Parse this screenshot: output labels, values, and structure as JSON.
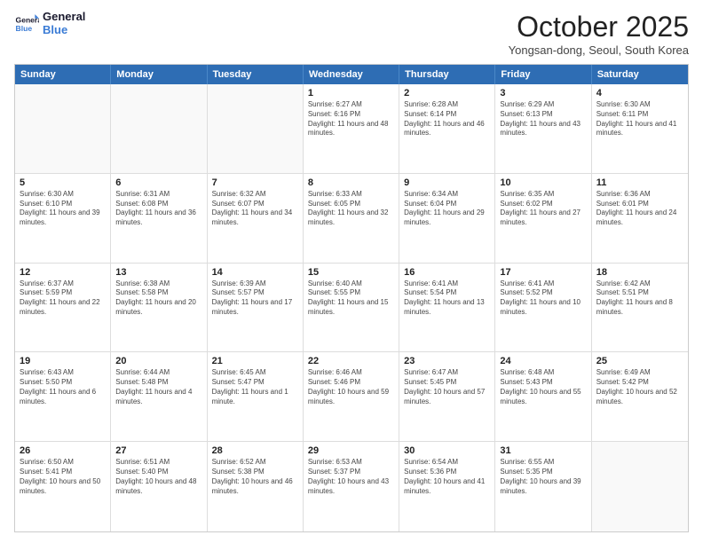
{
  "header": {
    "logo_line1": "General",
    "logo_line2": "Blue",
    "month": "October 2025",
    "location": "Yongsan-dong, Seoul, South Korea"
  },
  "days": [
    "Sunday",
    "Monday",
    "Tuesday",
    "Wednesday",
    "Thursday",
    "Friday",
    "Saturday"
  ],
  "weeks": [
    [
      {
        "date": "",
        "info": ""
      },
      {
        "date": "",
        "info": ""
      },
      {
        "date": "",
        "info": ""
      },
      {
        "date": "1",
        "info": "Sunrise: 6:27 AM\nSunset: 6:16 PM\nDaylight: 11 hours and 48 minutes."
      },
      {
        "date": "2",
        "info": "Sunrise: 6:28 AM\nSunset: 6:14 PM\nDaylight: 11 hours and 46 minutes."
      },
      {
        "date": "3",
        "info": "Sunrise: 6:29 AM\nSunset: 6:13 PM\nDaylight: 11 hours and 43 minutes."
      },
      {
        "date": "4",
        "info": "Sunrise: 6:30 AM\nSunset: 6:11 PM\nDaylight: 11 hours and 41 minutes."
      }
    ],
    [
      {
        "date": "5",
        "info": "Sunrise: 6:30 AM\nSunset: 6:10 PM\nDaylight: 11 hours and 39 minutes."
      },
      {
        "date": "6",
        "info": "Sunrise: 6:31 AM\nSunset: 6:08 PM\nDaylight: 11 hours and 36 minutes."
      },
      {
        "date": "7",
        "info": "Sunrise: 6:32 AM\nSunset: 6:07 PM\nDaylight: 11 hours and 34 minutes."
      },
      {
        "date": "8",
        "info": "Sunrise: 6:33 AM\nSunset: 6:05 PM\nDaylight: 11 hours and 32 minutes."
      },
      {
        "date": "9",
        "info": "Sunrise: 6:34 AM\nSunset: 6:04 PM\nDaylight: 11 hours and 29 minutes."
      },
      {
        "date": "10",
        "info": "Sunrise: 6:35 AM\nSunset: 6:02 PM\nDaylight: 11 hours and 27 minutes."
      },
      {
        "date": "11",
        "info": "Sunrise: 6:36 AM\nSunset: 6:01 PM\nDaylight: 11 hours and 24 minutes."
      }
    ],
    [
      {
        "date": "12",
        "info": "Sunrise: 6:37 AM\nSunset: 5:59 PM\nDaylight: 11 hours and 22 minutes."
      },
      {
        "date": "13",
        "info": "Sunrise: 6:38 AM\nSunset: 5:58 PM\nDaylight: 11 hours and 20 minutes."
      },
      {
        "date": "14",
        "info": "Sunrise: 6:39 AM\nSunset: 5:57 PM\nDaylight: 11 hours and 17 minutes."
      },
      {
        "date": "15",
        "info": "Sunrise: 6:40 AM\nSunset: 5:55 PM\nDaylight: 11 hours and 15 minutes."
      },
      {
        "date": "16",
        "info": "Sunrise: 6:41 AM\nSunset: 5:54 PM\nDaylight: 11 hours and 13 minutes."
      },
      {
        "date": "17",
        "info": "Sunrise: 6:41 AM\nSunset: 5:52 PM\nDaylight: 11 hours and 10 minutes."
      },
      {
        "date": "18",
        "info": "Sunrise: 6:42 AM\nSunset: 5:51 PM\nDaylight: 11 hours and 8 minutes."
      }
    ],
    [
      {
        "date": "19",
        "info": "Sunrise: 6:43 AM\nSunset: 5:50 PM\nDaylight: 11 hours and 6 minutes."
      },
      {
        "date": "20",
        "info": "Sunrise: 6:44 AM\nSunset: 5:48 PM\nDaylight: 11 hours and 4 minutes."
      },
      {
        "date": "21",
        "info": "Sunrise: 6:45 AM\nSunset: 5:47 PM\nDaylight: 11 hours and 1 minute."
      },
      {
        "date": "22",
        "info": "Sunrise: 6:46 AM\nSunset: 5:46 PM\nDaylight: 10 hours and 59 minutes."
      },
      {
        "date": "23",
        "info": "Sunrise: 6:47 AM\nSunset: 5:45 PM\nDaylight: 10 hours and 57 minutes."
      },
      {
        "date": "24",
        "info": "Sunrise: 6:48 AM\nSunset: 5:43 PM\nDaylight: 10 hours and 55 minutes."
      },
      {
        "date": "25",
        "info": "Sunrise: 6:49 AM\nSunset: 5:42 PM\nDaylight: 10 hours and 52 minutes."
      }
    ],
    [
      {
        "date": "26",
        "info": "Sunrise: 6:50 AM\nSunset: 5:41 PM\nDaylight: 10 hours and 50 minutes."
      },
      {
        "date": "27",
        "info": "Sunrise: 6:51 AM\nSunset: 5:40 PM\nDaylight: 10 hours and 48 minutes."
      },
      {
        "date": "28",
        "info": "Sunrise: 6:52 AM\nSunset: 5:38 PM\nDaylight: 10 hours and 46 minutes."
      },
      {
        "date": "29",
        "info": "Sunrise: 6:53 AM\nSunset: 5:37 PM\nDaylight: 10 hours and 43 minutes."
      },
      {
        "date": "30",
        "info": "Sunrise: 6:54 AM\nSunset: 5:36 PM\nDaylight: 10 hours and 41 minutes."
      },
      {
        "date": "31",
        "info": "Sunrise: 6:55 AM\nSunset: 5:35 PM\nDaylight: 10 hours and 39 minutes."
      },
      {
        "date": "",
        "info": ""
      }
    ]
  ]
}
